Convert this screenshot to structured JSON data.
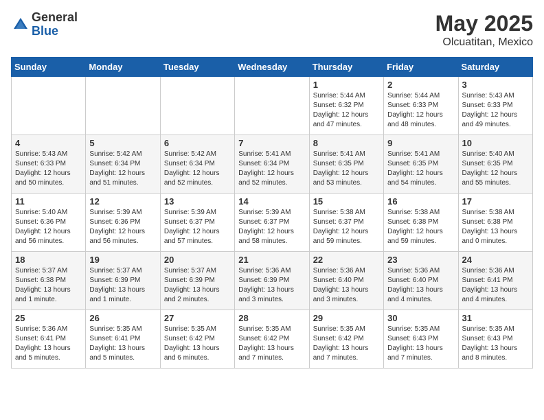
{
  "logo": {
    "general": "General",
    "blue": "Blue"
  },
  "title": "May 2025",
  "subtitle": "Olcuatitan, Mexico",
  "days": [
    "Sunday",
    "Monday",
    "Tuesday",
    "Wednesday",
    "Thursday",
    "Friday",
    "Saturday"
  ],
  "weeks": [
    [
      {
        "day": "",
        "info": ""
      },
      {
        "day": "",
        "info": ""
      },
      {
        "day": "",
        "info": ""
      },
      {
        "day": "",
        "info": ""
      },
      {
        "day": "1",
        "info": "Sunrise: 5:44 AM\nSunset: 6:32 PM\nDaylight: 12 hours\nand 47 minutes."
      },
      {
        "day": "2",
        "info": "Sunrise: 5:44 AM\nSunset: 6:33 PM\nDaylight: 12 hours\nand 48 minutes."
      },
      {
        "day": "3",
        "info": "Sunrise: 5:43 AM\nSunset: 6:33 PM\nDaylight: 12 hours\nand 49 minutes."
      }
    ],
    [
      {
        "day": "4",
        "info": "Sunrise: 5:43 AM\nSunset: 6:33 PM\nDaylight: 12 hours\nand 50 minutes."
      },
      {
        "day": "5",
        "info": "Sunrise: 5:42 AM\nSunset: 6:34 PM\nDaylight: 12 hours\nand 51 minutes."
      },
      {
        "day": "6",
        "info": "Sunrise: 5:42 AM\nSunset: 6:34 PM\nDaylight: 12 hours\nand 52 minutes."
      },
      {
        "day": "7",
        "info": "Sunrise: 5:41 AM\nSunset: 6:34 PM\nDaylight: 12 hours\nand 52 minutes."
      },
      {
        "day": "8",
        "info": "Sunrise: 5:41 AM\nSunset: 6:35 PM\nDaylight: 12 hours\nand 53 minutes."
      },
      {
        "day": "9",
        "info": "Sunrise: 5:41 AM\nSunset: 6:35 PM\nDaylight: 12 hours\nand 54 minutes."
      },
      {
        "day": "10",
        "info": "Sunrise: 5:40 AM\nSunset: 6:35 PM\nDaylight: 12 hours\nand 55 minutes."
      }
    ],
    [
      {
        "day": "11",
        "info": "Sunrise: 5:40 AM\nSunset: 6:36 PM\nDaylight: 12 hours\nand 56 minutes."
      },
      {
        "day": "12",
        "info": "Sunrise: 5:39 AM\nSunset: 6:36 PM\nDaylight: 12 hours\nand 56 minutes."
      },
      {
        "day": "13",
        "info": "Sunrise: 5:39 AM\nSunset: 6:37 PM\nDaylight: 12 hours\nand 57 minutes."
      },
      {
        "day": "14",
        "info": "Sunrise: 5:39 AM\nSunset: 6:37 PM\nDaylight: 12 hours\nand 58 minutes."
      },
      {
        "day": "15",
        "info": "Sunrise: 5:38 AM\nSunset: 6:37 PM\nDaylight: 12 hours\nand 59 minutes."
      },
      {
        "day": "16",
        "info": "Sunrise: 5:38 AM\nSunset: 6:38 PM\nDaylight: 12 hours\nand 59 minutes."
      },
      {
        "day": "17",
        "info": "Sunrise: 5:38 AM\nSunset: 6:38 PM\nDaylight: 13 hours\nand 0 minutes."
      }
    ],
    [
      {
        "day": "18",
        "info": "Sunrise: 5:37 AM\nSunset: 6:38 PM\nDaylight: 13 hours\nand 1 minute."
      },
      {
        "day": "19",
        "info": "Sunrise: 5:37 AM\nSunset: 6:39 PM\nDaylight: 13 hours\nand 1 minute."
      },
      {
        "day": "20",
        "info": "Sunrise: 5:37 AM\nSunset: 6:39 PM\nDaylight: 13 hours\nand 2 minutes."
      },
      {
        "day": "21",
        "info": "Sunrise: 5:36 AM\nSunset: 6:39 PM\nDaylight: 13 hours\nand 3 minutes."
      },
      {
        "day": "22",
        "info": "Sunrise: 5:36 AM\nSunset: 6:40 PM\nDaylight: 13 hours\nand 3 minutes."
      },
      {
        "day": "23",
        "info": "Sunrise: 5:36 AM\nSunset: 6:40 PM\nDaylight: 13 hours\nand 4 minutes."
      },
      {
        "day": "24",
        "info": "Sunrise: 5:36 AM\nSunset: 6:41 PM\nDaylight: 13 hours\nand 4 minutes."
      }
    ],
    [
      {
        "day": "25",
        "info": "Sunrise: 5:36 AM\nSunset: 6:41 PM\nDaylight: 13 hours\nand 5 minutes."
      },
      {
        "day": "26",
        "info": "Sunrise: 5:35 AM\nSunset: 6:41 PM\nDaylight: 13 hours\nand 5 minutes."
      },
      {
        "day": "27",
        "info": "Sunrise: 5:35 AM\nSunset: 6:42 PM\nDaylight: 13 hours\nand 6 minutes."
      },
      {
        "day": "28",
        "info": "Sunrise: 5:35 AM\nSunset: 6:42 PM\nDaylight: 13 hours\nand 7 minutes."
      },
      {
        "day": "29",
        "info": "Sunrise: 5:35 AM\nSunset: 6:42 PM\nDaylight: 13 hours\nand 7 minutes."
      },
      {
        "day": "30",
        "info": "Sunrise: 5:35 AM\nSunset: 6:43 PM\nDaylight: 13 hours\nand 7 minutes."
      },
      {
        "day": "31",
        "info": "Sunrise: 5:35 AM\nSunset: 6:43 PM\nDaylight: 13 hours\nand 8 minutes."
      }
    ]
  ]
}
